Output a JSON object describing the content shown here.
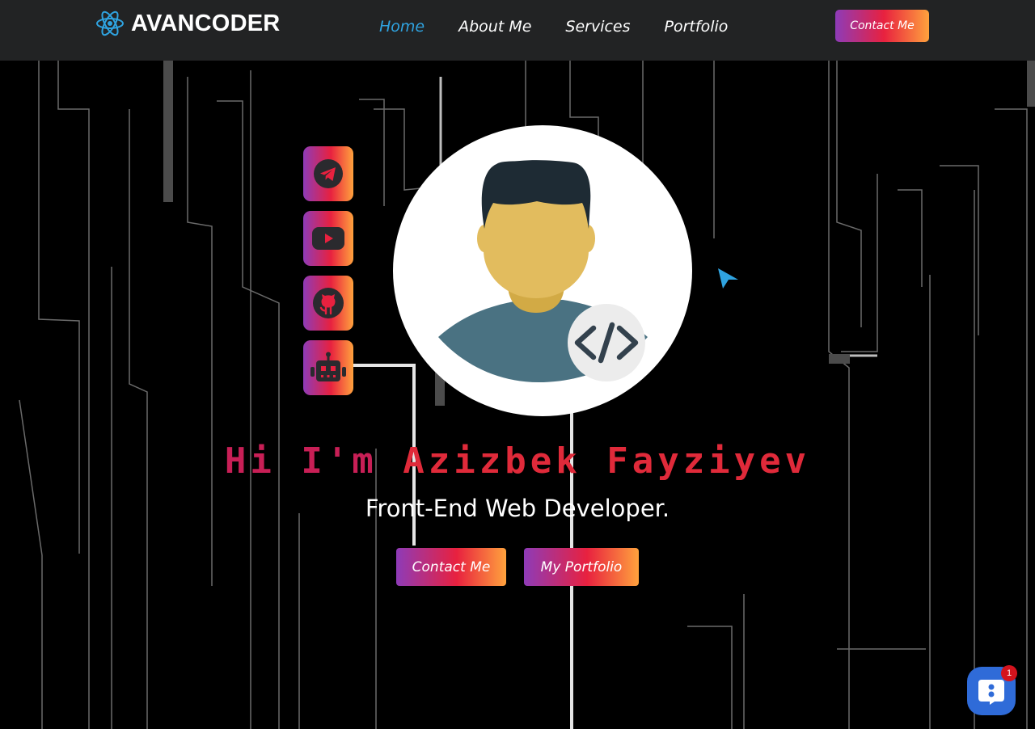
{
  "brand": {
    "name": "AVANCODER",
    "logo_icon": "react-atom-icon"
  },
  "nav": {
    "links": [
      {
        "label": "Home",
        "active": true
      },
      {
        "label": "About Me",
        "active": false
      },
      {
        "label": "Services",
        "active": false
      },
      {
        "label": "Portfolio",
        "active": false
      }
    ],
    "cta_label": "Contact Me"
  },
  "social": [
    {
      "icon": "telegram-icon"
    },
    {
      "icon": "youtube-icon"
    },
    {
      "icon": "github-icon"
    },
    {
      "icon": "robot-icon"
    }
  ],
  "hero": {
    "greeting": "Hi I'm ",
    "name": "Azizbek Fayziyev",
    "subtitle": "Front-End Web Developer.",
    "buttons": {
      "contact": "Contact Me",
      "portfolio": "My Portfolio"
    }
  },
  "chat": {
    "badge_count": "1",
    "icon": "chat-bubble-icon"
  },
  "colors": {
    "navbar_bg": "#222324",
    "nav_active": "#2fa3e0",
    "gradient_start": "#8e3bb8",
    "gradient_mid": "#e8213f",
    "gradient_end": "#ffa23d",
    "title_red": "#e02a3a"
  }
}
